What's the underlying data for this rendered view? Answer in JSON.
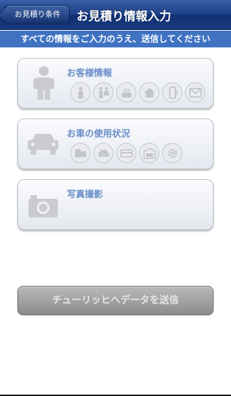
{
  "nav": {
    "back_label": "お見積り条件",
    "title": "お見積り情報入力"
  },
  "info_text": "すべての情報をご入力のうえ、送信してください",
  "cards": [
    {
      "title": "お客様情報",
      "main_icon": "person-icon",
      "icons": [
        "person-icon",
        "couple-icon",
        "cake-icon",
        "house-icon",
        "phone-icon",
        "mail-icon"
      ]
    },
    {
      "title": "お車の使用状況",
      "main_icon": "car-icon",
      "icons": [
        "car-document-icon",
        "odometer-icon",
        "card-icon",
        "garage-icon",
        "gear-icon"
      ]
    },
    {
      "title": "写真撮影",
      "main_icon": "camera-icon",
      "icons": []
    }
  ],
  "send_button": "チューリッヒへデータを送信",
  "colors": {
    "navbar": "#1c3f86",
    "info_bar": "#3f73c2",
    "card_title": "#6a8ec8",
    "disabled_button": "#8c8c8c"
  }
}
